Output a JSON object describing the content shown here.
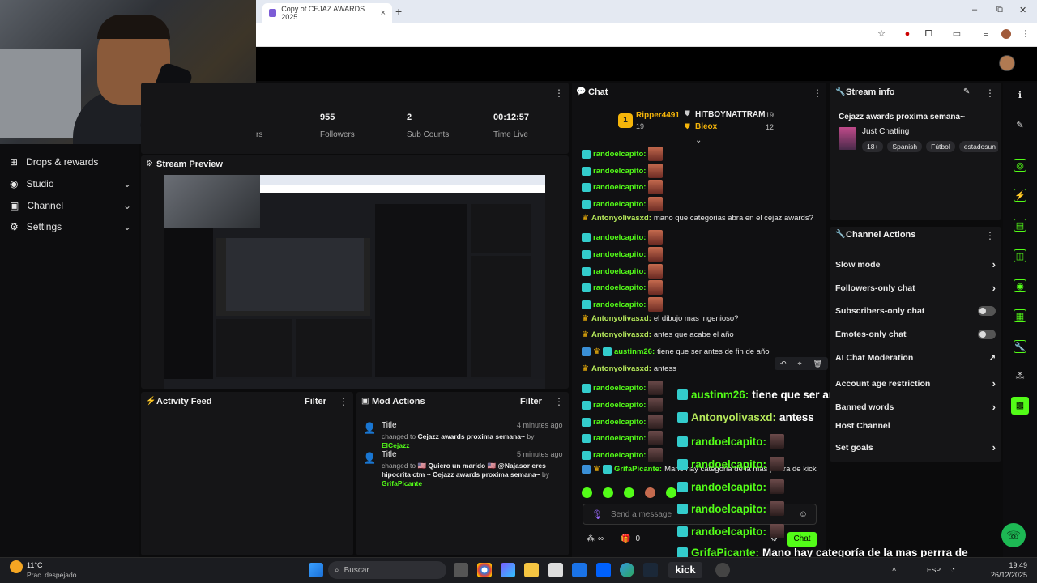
{
  "browser": {
    "tab_title": "Copy of CEJAZ AWARDS 2025",
    "close_tab": "×",
    "new_tab": "+",
    "win_min": "–",
    "win_max": "⧉",
    "win_close": "✕"
  },
  "sidebar": {
    "items": [
      {
        "label": "Drops & rewards",
        "icon": "gift-icon"
      },
      {
        "label": "Studio",
        "icon": "studio-icon"
      },
      {
        "label": "Channel",
        "icon": "channel-icon"
      },
      {
        "label": "Settings",
        "icon": "gear-icon"
      }
    ]
  },
  "stats": {
    "partial_label": "rs",
    "followers_value": "955",
    "followers_label": "Followers",
    "subs_value": "2",
    "subs_label": "Sub Counts",
    "time_value": "00:12:57",
    "time_label": "Time Live"
  },
  "preview": {
    "title": "Stream Preview"
  },
  "activity": {
    "title": "Activity Feed",
    "filter": "Filter"
  },
  "mod_actions": {
    "title": "Mod Actions",
    "filter": "Filter",
    "entries": [
      {
        "title": "Title",
        "time": "4 minutes ago",
        "changed": "changed to",
        "value": "Cejazz awards proxima semana~",
        "by": "by",
        "user": "ElCejazz"
      },
      {
        "title": "Title",
        "time": "5 minutes ago",
        "changed": "changed to",
        "value": "🇺🇸 Quiero un marido 🇺🇸 @Najasor eres hipocrita ctm ~ Cejazz awards proxima semana~",
        "by": "by",
        "user": "GrifaPicante"
      }
    ]
  },
  "chat": {
    "title": "Chat",
    "leaders": [
      {
        "rank": "1",
        "name": "Ripper4491",
        "count": "19"
      },
      {
        "name": "HITBOYNATTRAM",
        "count": "19"
      },
      {
        "name": "Bleox",
        "count": "12"
      }
    ],
    "messages": [
      {
        "user": "randoelcapito:",
        "text": "",
        "type": "emote"
      },
      {
        "user": "randoelcapito:",
        "text": "",
        "type": "emote"
      },
      {
        "user": "randoelcapito:",
        "text": "",
        "type": "emote"
      },
      {
        "user": "randoelcapito:",
        "text": "",
        "type": "emote"
      },
      {
        "user": "Antonyolivasxd:",
        "text": "mano que categorias abra en el cejaz awards?",
        "type": "text"
      },
      {
        "user": "randoelcapito:",
        "text": "",
        "type": "emote"
      },
      {
        "user": "randoelcapito:",
        "text": "",
        "type": "emote"
      },
      {
        "user": "randoelcapito:",
        "text": "",
        "type": "emote"
      },
      {
        "user": "randoelcapito:",
        "text": "",
        "type": "emote"
      },
      {
        "user": "randoelcapito:",
        "text": "",
        "type": "emote"
      },
      {
        "user": "Antonyolivasxd:",
        "text": "el dibujo mas ingenioso?",
        "type": "text"
      },
      {
        "user": "Antonyolivasxd:",
        "text": "antes que acabe el año",
        "type": "text"
      },
      {
        "user": "austinm26:",
        "text": "tiene que ser antes de fin de año",
        "type": "text"
      },
      {
        "user": "Antonyolivasxd:",
        "text": "antess",
        "type": "text"
      },
      {
        "user": "randoelcapito:",
        "text": "",
        "type": "emote2"
      },
      {
        "user": "randoelcapito:",
        "text": "",
        "type": "emote2"
      },
      {
        "user": "randoelcapito:",
        "text": "",
        "type": "emote2"
      },
      {
        "user": "randoelcapito:",
        "text": "",
        "type": "emote2"
      },
      {
        "user": "randoelcapito:",
        "text": "",
        "type": "emote2"
      },
      {
        "user": "GrifaPicante:",
        "text": "Mano hay categoria de la mas perrra de kick",
        "type": "text"
      }
    ],
    "input_placeholder": "Send a message",
    "chat_button": "Chat",
    "points_value": "0",
    "infinity": "∞"
  },
  "overlay": {
    "lines": [
      {
        "user": "austinm26:",
        "text": "tiene que ser antes de fin de año"
      },
      {
        "user": "Antonyolivasxd:",
        "text": "antess"
      },
      {
        "user": "randoelcapito:",
        "text": ""
      },
      {
        "user": "randoelcapito:",
        "text": ""
      },
      {
        "user": "randoelcapito:",
        "text": ""
      },
      {
        "user": "randoelcapito:",
        "text": ""
      },
      {
        "user": "randoelcapito:",
        "text": ""
      },
      {
        "user": "GrifaPicante:",
        "text": "Mano hay categoría de la mas perrra de"
      }
    ]
  },
  "stream_info": {
    "title": "Stream info",
    "stream_title": "Cejazz awards proxima semana~",
    "category": "Just Chatting",
    "tags": [
      "18+",
      "Spanish",
      "Fútbol",
      "estadosun"
    ]
  },
  "channel_actions": {
    "title": "Channel Actions",
    "items": [
      {
        "label": "Slow mode",
        "control": "chevron"
      },
      {
        "label": "Followers-only chat",
        "control": "chevron"
      },
      {
        "label": "Subscribers-only chat",
        "control": "toggle"
      },
      {
        "label": "Emotes-only chat",
        "control": "toggle"
      },
      {
        "label": "AI Chat Moderation",
        "control": "external"
      },
      {
        "label": "Account age restriction",
        "control": "chevron"
      },
      {
        "label": "Banned words",
        "control": "chevron"
      },
      {
        "label": "Host Channel",
        "control": "none"
      },
      {
        "label": "Set goals",
        "control": "chevron"
      }
    ]
  },
  "taskbar": {
    "weather_temp": "11°C",
    "weather_desc": "Prac. despejado",
    "search_placeholder": "Buscar",
    "language": "ESP",
    "time": "19:49",
    "date": "26/12/2025",
    "kick_label": "kick"
  },
  "colors": {
    "accent": "#53fc18",
    "panel": "#151517",
    "bg": "#0b0b0c"
  }
}
